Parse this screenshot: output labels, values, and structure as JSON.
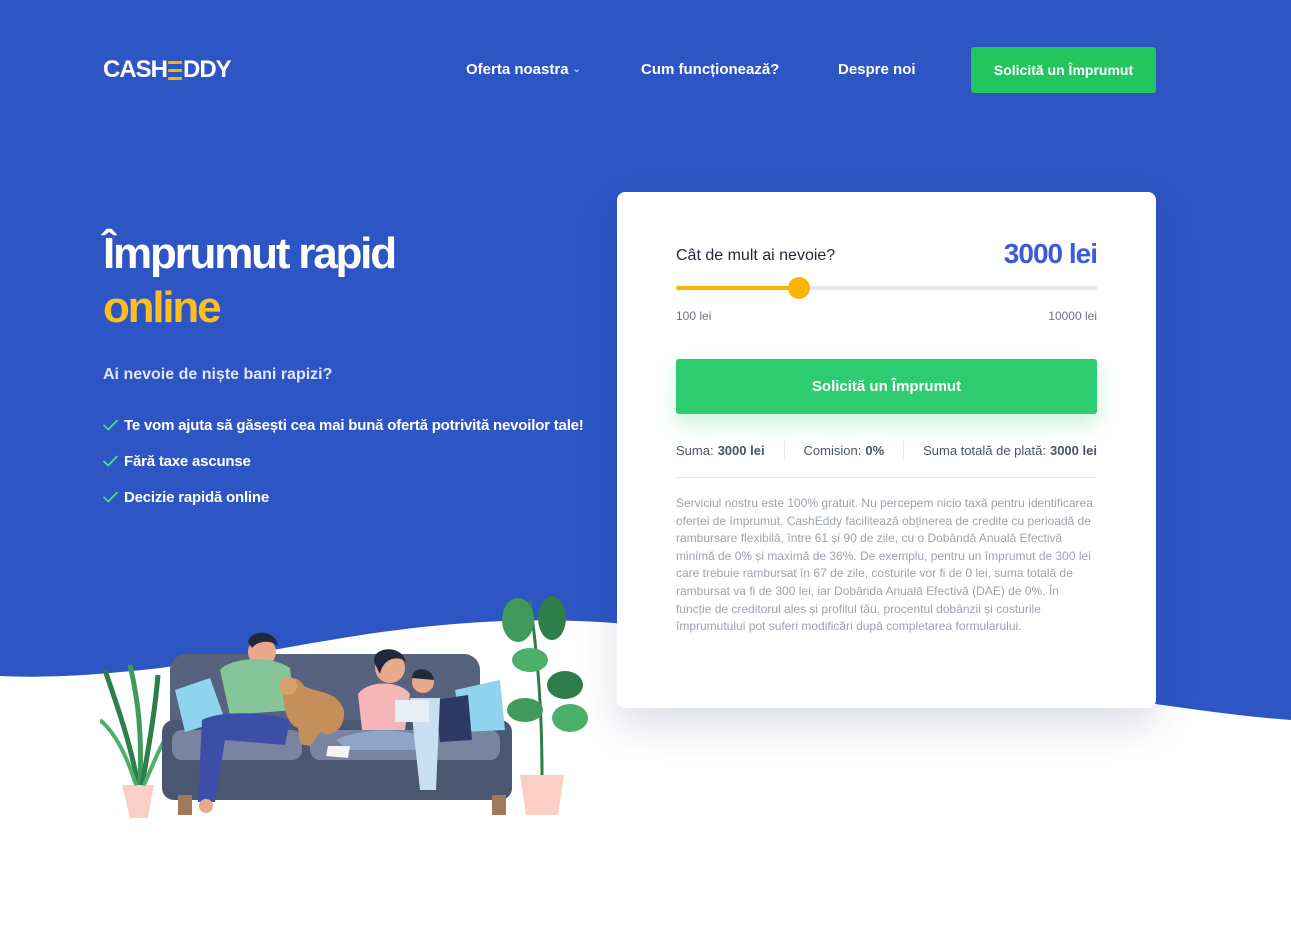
{
  "brand": {
    "logo_left": "CASH",
    "logo_right": "DDY",
    "accent": "#f7b500",
    "hero_color": "#2d55c3",
    "cta_color": "#22c55e"
  },
  "nav": {
    "items": [
      {
        "label": "Oferta noastra",
        "has_dropdown": true
      },
      {
        "label": "Cum funcționează?"
      },
      {
        "label": "Despre noi"
      }
    ],
    "cta_label": "Solicită un Împrumut"
  },
  "hero": {
    "title_line1": "Împrumut rapid",
    "title_line2": "online",
    "subtitle": "Ai nevoie de niște bani rapizi?",
    "features": [
      "Te vom ajuta să găsești cea mai bună ofertă potrivită nevoilor tale!",
      "Fără taxe ascunse",
      "Decizie rapidă online"
    ]
  },
  "calculator": {
    "question": "Cât de mult ai nevoie?",
    "amount_display": "3000 lei",
    "slider": {
      "min": 100,
      "max": 10000,
      "value": 3000
    },
    "min_label": "100 lei",
    "max_label": "10000 lei",
    "cta_label": "Solicită un Împrumut",
    "summary": [
      {
        "label": "Suma:",
        "value": "3000 lei"
      },
      {
        "label": "Comision:",
        "value": "0%"
      },
      {
        "label": "Suma totală de plată:",
        "value": "3000 lei"
      }
    ],
    "disclaimer": "Serviciul nostru este 100% gratuit. Nu percepem nicio taxă pentru identificarea ofertei de împrumut. CashEddy facilitează obținerea de credite cu perioadă de rambursare flexibilă, între 61 și 90 de zile, cu o Dobândă Anuală Efectivă minimă de 0% și maximă de 36%. De exemplu, pentru un împrumut de 300 lei care trebuie rambursat în 67 de zile, costurile vor fi de 0 lei, suma totală de rambursat va fi de 300 lei, iar Dobânda Anuală Efectivă (DAE) de 0%. În funcție de creditorul ales și profilul tău, procentul dobânzii și costurile împrumutului pot suferi modificări după completarea formularului."
  }
}
